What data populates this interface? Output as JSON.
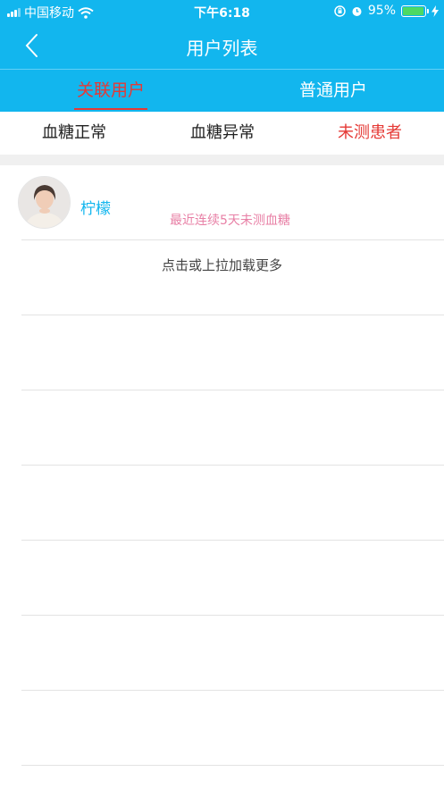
{
  "status_bar": {
    "carrier": "中国移动",
    "time": "下午6:18",
    "battery": "95%",
    "battery_level": 0.95
  },
  "nav": {
    "title": "用户列表"
  },
  "tabs": [
    {
      "label": "关联用户",
      "active": true
    },
    {
      "label": "普通用户",
      "active": false
    }
  ],
  "filters": [
    {
      "label": "血糖正常",
      "active": false
    },
    {
      "label": "血糖异常",
      "active": false
    },
    {
      "label": "未测患者",
      "active": true
    }
  ],
  "users": [
    {
      "name": "柠檬",
      "note": "最近连续5天未测血糖"
    }
  ],
  "load_more": "点击或上拉加载更多",
  "colors": {
    "primary": "#12b6ee",
    "accent_red": "#e53935",
    "note_pink": "#e880a6"
  }
}
